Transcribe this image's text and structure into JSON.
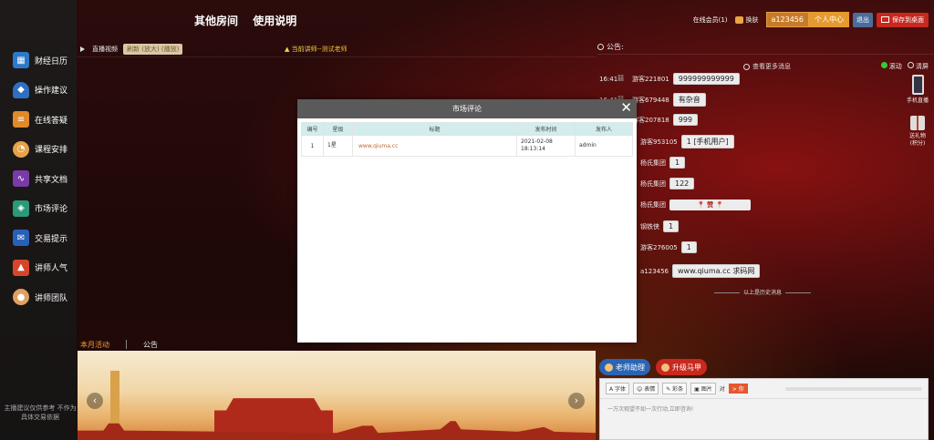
{
  "topnav": {
    "item1": "其他房间",
    "item2": "使用说明"
  },
  "header": {
    "online": "在线会员(1)",
    "skin": "换肤",
    "username": "a123456",
    "user_center": "个人中心",
    "logout": "退出",
    "save_desktop": "保存到桌面",
    "colors": {
      "orange": "#e69a2e",
      "blue": "#4a6d9a",
      "red": "#c8281e"
    }
  },
  "sidebar": {
    "items": [
      {
        "label": "财经日历",
        "icon": "calendar-icon"
      },
      {
        "label": "操作建议",
        "icon": "bell-icon"
      },
      {
        "label": "在线答疑",
        "icon": "document-icon"
      },
      {
        "label": "课程安排",
        "icon": "clock-user-icon"
      },
      {
        "label": "共享文档",
        "icon": "chart-icon"
      },
      {
        "label": "市场评论",
        "icon": "stack-icon"
      },
      {
        "label": "交易提示",
        "icon": "mail-icon"
      },
      {
        "label": "讲师人气",
        "icon": "thumbs-up-icon"
      },
      {
        "label": "讲师团队",
        "icon": "person-icon"
      }
    ],
    "disclaimer": "主播建议仅供参考 不作为具体交易依据"
  },
  "video": {
    "live_label": "直播视频",
    "refresh_label": "刷新 (放大) (播放)",
    "teacher_prefix": "当前讲师--",
    "teacher_name": "测试老师"
  },
  "notice": {
    "label": "公告:",
    "more": "查看更多消息",
    "scroll_ctrl": "滚动",
    "clear_ctrl": "清屏",
    "phone_label": "手机直播",
    "gift_label": "送礼物",
    "gift_sub": "(积分)",
    "history": "以上是历史消息"
  },
  "chat": {
    "messages": [
      {
        "time": "16:41",
        "nick": "游客221801",
        "text": "999999999999"
      },
      {
        "time": "16:41",
        "nick": "游客679448",
        "text": "有杂音"
      },
      {
        "time": "",
        "nick": "游客207818",
        "text": "999"
      },
      {
        "time": "",
        "nick": "游客953105",
        "text": "1 [手机用户]"
      },
      {
        "time": "",
        "nick": "杨氏集团",
        "text": "1"
      },
      {
        "time": "",
        "nick": "杨氏集团",
        "text": "122"
      },
      {
        "time": "",
        "nick": "杨氏集团",
        "text": "📍 赞 📍"
      },
      {
        "time": "",
        "nick": "钢铁侠",
        "text": "1"
      },
      {
        "time": "",
        "nick": "游客276005",
        "text": "1"
      },
      {
        "time": "",
        "nick": "a123456",
        "text": "www.qiuma.cc 求码网"
      }
    ]
  },
  "bottom": {
    "tab_active": "本月活动",
    "tab_other": "公告",
    "prev_arrow": "‹",
    "next_arrow": "›"
  },
  "input_panel": {
    "assistant": "老师助理",
    "upgrade": "升级马甲",
    "tool_font": "字体",
    "tool_emoji": "表情",
    "tool_color": "彩条",
    "tool_image": "图片",
    "tool_to": "对",
    "tool_target": "> 你",
    "placeholder": "一万次观望不如一次行动,立即咨询!"
  },
  "modal": {
    "title": "市场评论",
    "close": "✕",
    "headers": [
      "编号",
      "星级",
      "标题",
      "发布时间",
      "发布人"
    ],
    "rows": [
      {
        "id": "1",
        "star": "1星",
        "title": "www.qiuma.cc",
        "time": "2021-02-08 18:13:14",
        "author": "admin"
      }
    ]
  }
}
